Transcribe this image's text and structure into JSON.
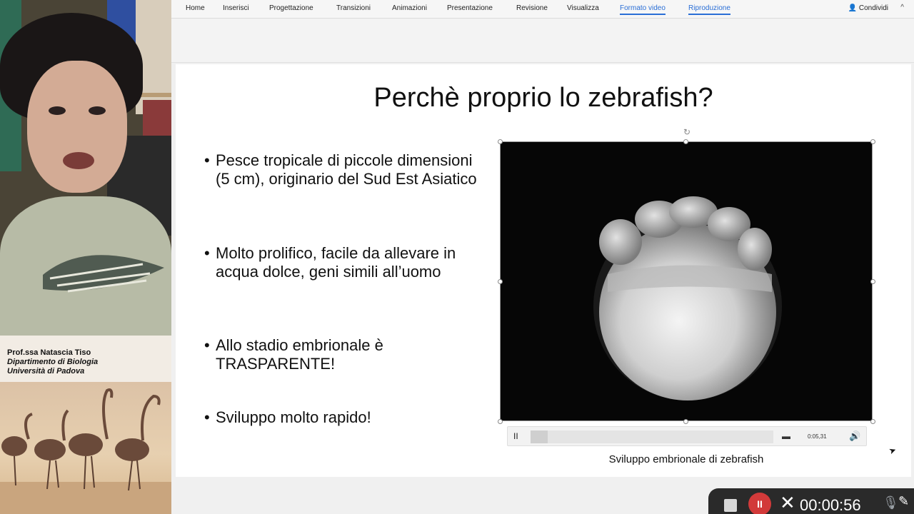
{
  "ribbon": {
    "tabs": [
      {
        "label": "Home"
      },
      {
        "label": "Inserisci"
      },
      {
        "label": "Progettazione"
      },
      {
        "label": "Transizioni"
      },
      {
        "label": "Animazioni"
      },
      {
        "label": "Presentazione"
      },
      {
        "label": "Revisione"
      },
      {
        "label": "Visualizza"
      },
      {
        "label": "Formato video"
      },
      {
        "label": "Riproduzione"
      }
    ],
    "share_label": "Condividi",
    "share_icon": "person-plus-icon",
    "chevron": "^"
  },
  "presenter": {
    "name": "Prof.ssa Natascia Tiso",
    "department": "Dipartimento di Biologia",
    "university": "Università di Padova"
  },
  "slide": {
    "title": "Perchè proprio lo zebrafish?",
    "bullets": [
      "Pesce tropicale di piccole dimensioni (5 cm), originario del Sud Est Asiatico",
      "Molto prolifico, facile da allevare in acqua dolce, geni simili all’uomo",
      "Allo stadio embrionale è TRASPARENTE!",
      "Sviluppo molto rapido!"
    ],
    "bullet_glyph": "•",
    "video_caption": "Sviluppo embrionale di zebrafish",
    "player": {
      "time": "0:05,31",
      "pause_glyph": "II",
      "cc_glyph": "▬",
      "volume_glyph": "🔊",
      "rotate_glyph": "↻"
    }
  },
  "recording": {
    "elapsed": "00:00:56",
    "pause_glyph": "II",
    "close_glyph": "✕",
    "mic_glyph": "🎙",
    "pen_glyph": "✎"
  },
  "cursor_glyph": "➤",
  "colors": {
    "accent": "#2b6fd6",
    "record": "#d23a3a"
  }
}
